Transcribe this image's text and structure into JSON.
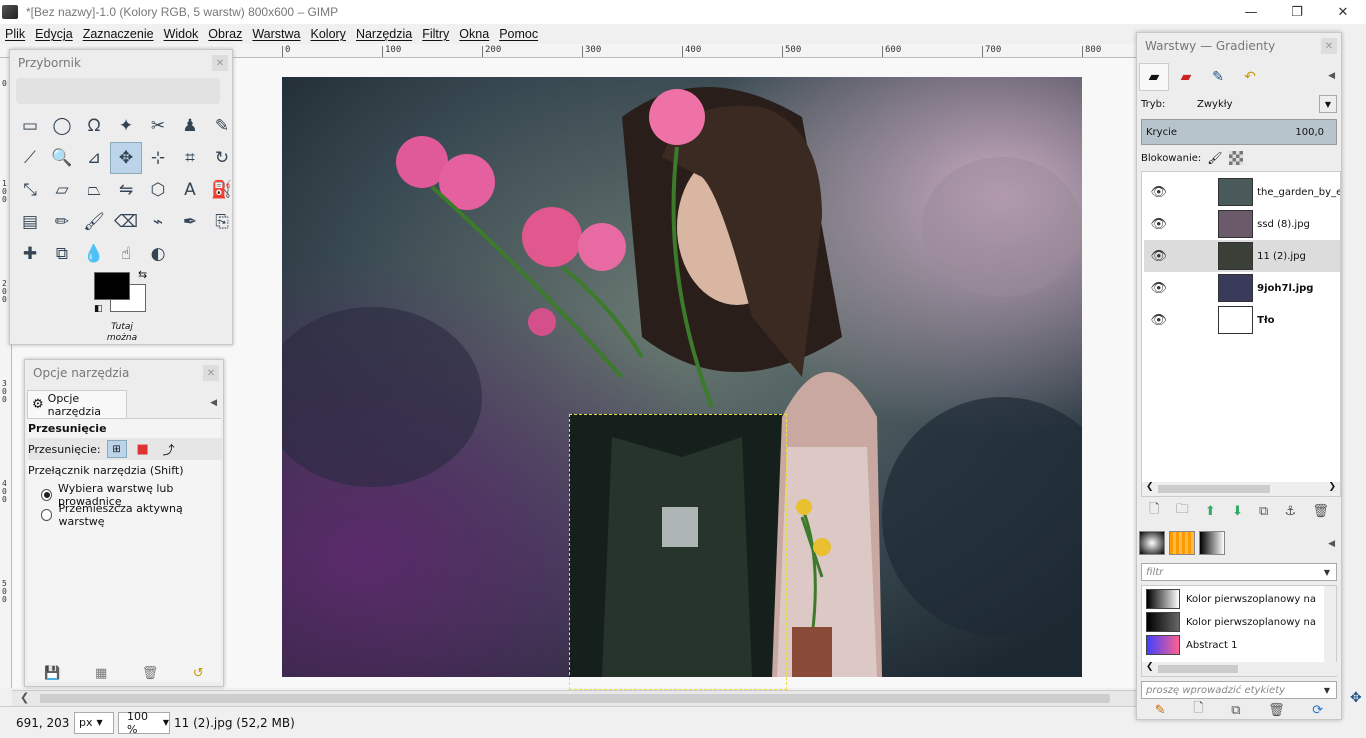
{
  "window": {
    "title": "*[Bez nazwy]-1.0 (Kolory RGB, 5 warstw) 800x600 – GIMP",
    "min": "—",
    "max": "❐",
    "close": "✕"
  },
  "menu": [
    "Plik",
    "Edycja",
    "Zaznaczenie",
    "Widok",
    "Obraz",
    "Warstwa",
    "Kolory",
    "Narzędzia",
    "Filtry",
    "Okna",
    "Pomoc"
  ],
  "ruler": {
    "top": [
      "0",
      "100",
      "200",
      "300",
      "400",
      "500",
      "600",
      "700",
      "800"
    ],
    "left": [
      "0",
      "100",
      "200",
      "300",
      "400",
      "500"
    ]
  },
  "toolbox": {
    "title": "Przybornik",
    "close": "✕",
    "tools": [
      {
        "name": "rect-select-icon",
        "glyph": "▭"
      },
      {
        "name": "ellipse-select-icon",
        "glyph": "◯"
      },
      {
        "name": "free-select-icon",
        "glyph": "ᘯ"
      },
      {
        "name": "fuzzy-select-icon",
        "glyph": "✦"
      },
      {
        "name": "scissors-icon",
        "glyph": "✂"
      },
      {
        "name": "foreground-select-icon",
        "glyph": "♟"
      },
      {
        "name": "paths-icon",
        "glyph": "✎"
      },
      {
        "name": "color-picker-icon",
        "glyph": "⟋"
      },
      {
        "name": "zoom-icon",
        "glyph": "🔍"
      },
      {
        "name": "measure-icon",
        "glyph": "⊿"
      },
      {
        "name": "move-icon",
        "glyph": "✥"
      },
      {
        "name": "align-icon",
        "glyph": "⊹"
      },
      {
        "name": "crop-icon",
        "glyph": "⌗"
      },
      {
        "name": "rotate-icon",
        "glyph": "↻"
      },
      {
        "name": "scale-icon",
        "glyph": "⤡"
      },
      {
        "name": "shear-icon",
        "glyph": "▱"
      },
      {
        "name": "perspective-icon",
        "glyph": "⏢"
      },
      {
        "name": "flip-icon",
        "glyph": "⇋"
      },
      {
        "name": "cage-icon",
        "glyph": "⬡"
      },
      {
        "name": "text-icon",
        "glyph": "A"
      },
      {
        "name": "bucket-fill-icon",
        "glyph": "⛽"
      },
      {
        "name": "blend-icon",
        "glyph": "▤"
      },
      {
        "name": "pencil-icon",
        "glyph": "✏"
      },
      {
        "name": "paintbrush-icon",
        "glyph": "🖌"
      },
      {
        "name": "eraser-icon",
        "glyph": "⌫"
      },
      {
        "name": "airbrush-icon",
        "glyph": "⌁"
      },
      {
        "name": "ink-icon",
        "glyph": "✒"
      },
      {
        "name": "clone-icon",
        "glyph": "⎘"
      },
      {
        "name": "heal-icon",
        "glyph": "✚"
      },
      {
        "name": "perspective-clone-icon",
        "glyph": "⧉"
      },
      {
        "name": "blur-icon",
        "glyph": "💧"
      },
      {
        "name": "smudge-icon",
        "glyph": "☝"
      },
      {
        "name": "dodge-burn-icon",
        "glyph": "◐"
      }
    ],
    "hint": [
      "Tutaj",
      "można"
    ]
  },
  "tool_options": {
    "title": "Opcje narzędzia",
    "close": "✕",
    "tab": "Opcje narzędzia",
    "tool_name": "Przesunięcie",
    "move_label": "Przesunięcie:",
    "toggle_label": "Przełącznik narzędzia  (Shift)",
    "radio1": "Wybiera warstwę lub prowadnicę",
    "radio2": "Przemieszcza aktywną warstwę"
  },
  "layers": {
    "title": "Warstwy — Gradienty",
    "close": "✕",
    "mode_label": "Tryb:",
    "mode_value": "Zwykły",
    "opacity_label": "Krycie",
    "opacity_value": "100,0",
    "lock_label": "Blokowanie:",
    "items": [
      {
        "name": "the_garden_by_em",
        "bold": false,
        "selected": false,
        "thumb": "#4a5a5a"
      },
      {
        "name": "ssd (8).jpg",
        "bold": false,
        "selected": false,
        "thumb": "#6a5a6a"
      },
      {
        "name": "11 (2).jpg",
        "bold": false,
        "selected": true,
        "thumb": "#3a4038"
      },
      {
        "name": "9joh7l.jpg",
        "bold": true,
        "selected": false,
        "thumb": "#3a3a5a"
      },
      {
        "name": "Tło",
        "bold": true,
        "selected": false,
        "thumb": "#ffffff"
      }
    ]
  },
  "gradients": {
    "filter_placeholder": "filtr",
    "items": [
      {
        "name": "Kolor pierwszoplanowy na kolor",
        "c1": "#000000",
        "c2": "#ffffff"
      },
      {
        "name": "Kolor pierwszoplanowy na prze",
        "c1": "#000000",
        "c2": "#666666"
      },
      {
        "name": "Abstract 1",
        "c1": "#4040ff",
        "c2": "#ff6090"
      }
    ],
    "tag_placeholder": "proszę wprowadzić etykiety"
  },
  "status": {
    "coords": "691, 203",
    "unit": "px",
    "zoom": "100 %",
    "info": "11 (2).jpg (52,2 MB)"
  }
}
